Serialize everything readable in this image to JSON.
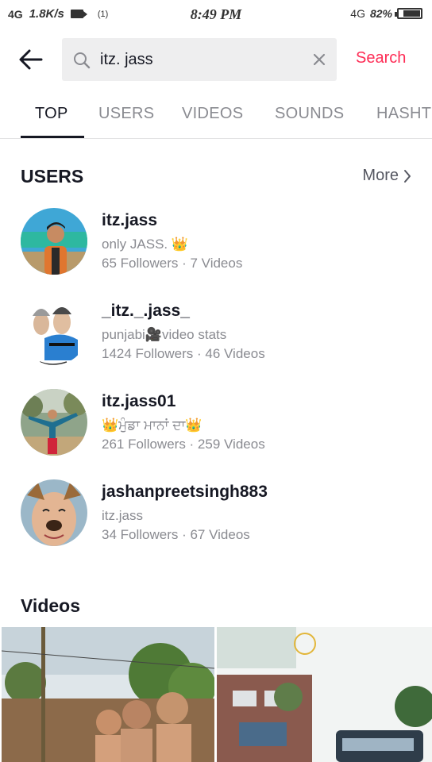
{
  "status_bar": {
    "network": "4G",
    "speed": "1.8K/s",
    "hotspot": "(1)",
    "time": "8:49 PM",
    "signal_right": "4G",
    "battery": "82%"
  },
  "search": {
    "query": "itz. jass",
    "button_label": "Search"
  },
  "tabs": [
    "TOP",
    "USERS",
    "VIDEOS",
    "SOUNDS",
    "HASHT"
  ],
  "users_section": {
    "title": "USERS",
    "more_label": "More",
    "items": [
      {
        "name": "itz.jass",
        "bio": "only JASS. 👑",
        "stats": "65 Followers · 7 Videos"
      },
      {
        "name": "_itz._.jass_",
        "bio": "punjabi🎥video stats",
        "stats": "1424 Followers · 46 Videos"
      },
      {
        "name": "itz.jass01",
        "bio": "👑ਮੁੰਡਾ ਮਾਨਾਂ ਦਾ👑",
        "stats": "261 Followers · 259 Videos"
      },
      {
        "name": "jashanpreetsingh883",
        "bio": "itz.jass",
        "stats": "34 Followers · 67 Videos"
      }
    ]
  },
  "videos_section": {
    "title": "Videos"
  },
  "colors": {
    "accent": "#fe2c55",
    "text_primary": "#161823",
    "text_secondary": "#8a8b91",
    "search_bg": "#eeeeef"
  }
}
